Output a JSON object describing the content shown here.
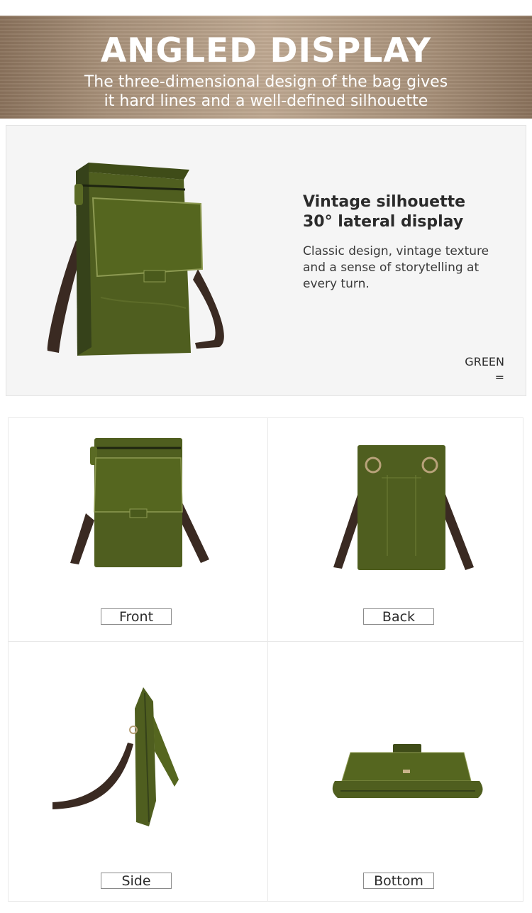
{
  "banner": {
    "title": "ANGLED DISPLAY",
    "subtitle_line1": "The three-dimensional design of the bag gives",
    "subtitle_line2": "it hard lines and a well-defined silhouette"
  },
  "hero": {
    "title_line1": "Vintage silhouette",
    "title_line2": "30° lateral display",
    "desc_line1": "Classic design, vintage texture",
    "desc_line2": "and a sense of storytelling at",
    "desc_line3": "every turn.",
    "color_label": "GREEN",
    "color_symbol": "="
  },
  "views": {
    "front": "Front",
    "back": "Back",
    "side": "Side",
    "bottom": "Bottom"
  },
  "colors": {
    "leather": "#4f5e1f",
    "leather_dark": "#36421a",
    "strap": "#3a2a22",
    "banner": "#a8917a"
  }
}
